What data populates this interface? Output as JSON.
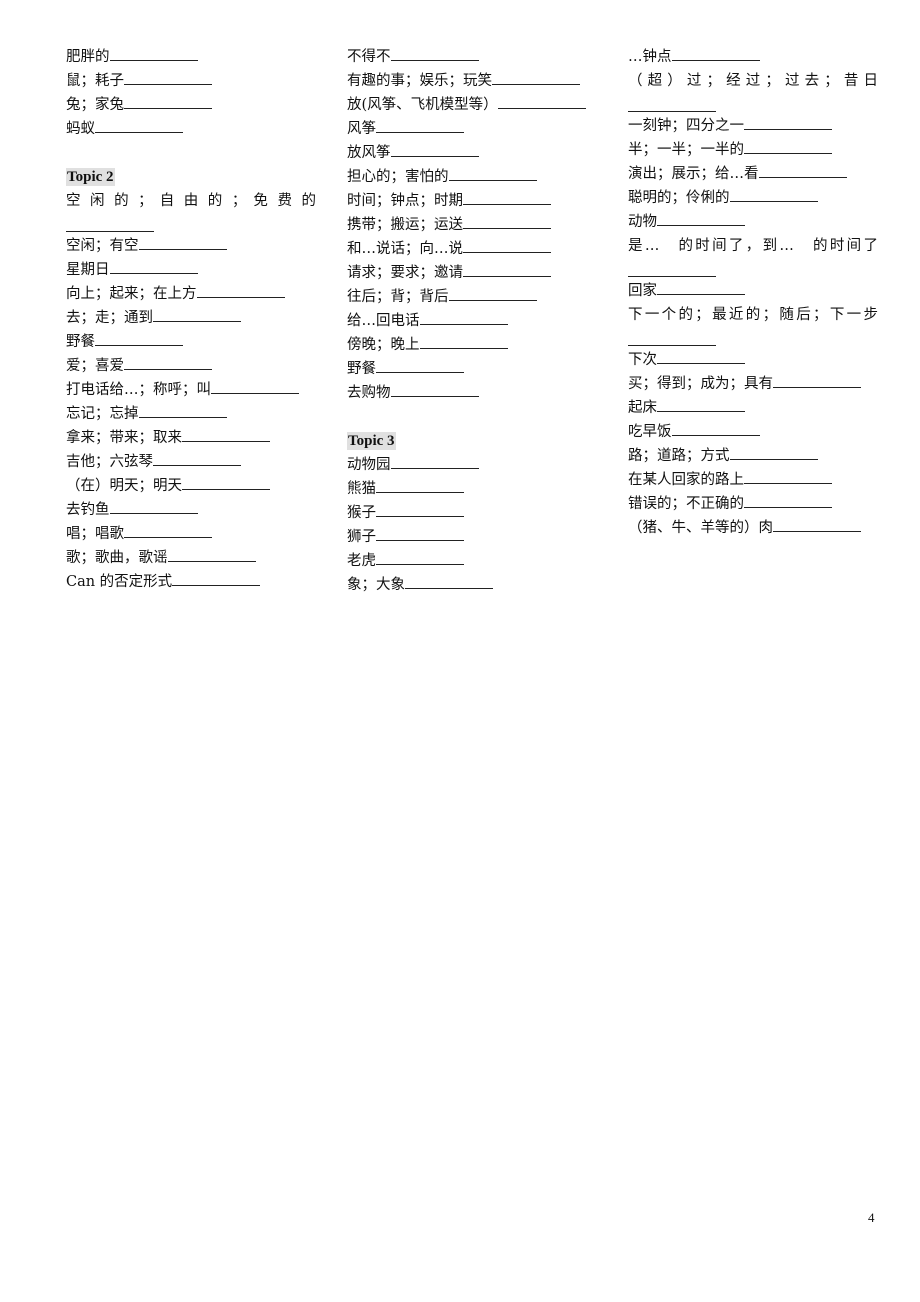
{
  "columns": [
    {
      "blocks": [
        {
          "type": "item",
          "text": "肥胖的"
        },
        {
          "type": "item",
          "text": "鼠；耗子"
        },
        {
          "type": "item",
          "text": "兔；家兔"
        },
        {
          "type": "item",
          "text": "蚂蚁"
        },
        {
          "type": "spacer"
        },
        {
          "type": "topic",
          "text": "Topic 2"
        },
        {
          "type": "wrap",
          "text": "空 闲 的 ； 自 由 的 ； 免 费 的"
        },
        {
          "type": "item",
          "text": "空闲；有空"
        },
        {
          "type": "item",
          "text": "星期日"
        },
        {
          "type": "item",
          "text": "向上；起来；在上方"
        },
        {
          "type": "item",
          "text": "去；走；通到"
        },
        {
          "type": "item",
          "text": "野餐"
        },
        {
          "type": "item",
          "text": "爱；喜爱"
        },
        {
          "type": "item",
          "text": "打电话给…；称呼；叫"
        },
        {
          "type": "item",
          "text": "忘记；忘掉"
        },
        {
          "type": "item",
          "text": "拿来；带来；取来"
        },
        {
          "type": "item",
          "text": "吉他；六弦琴"
        },
        {
          "type": "item",
          "text": "（在）明天；明天"
        },
        {
          "type": "item",
          "text": "去钓鱼"
        },
        {
          "type": "item",
          "text": "唱；唱歌"
        },
        {
          "type": "item",
          "text": "歌；歌曲，歌谣"
        },
        {
          "type": "item",
          "text": "Can 的否定形式"
        }
      ]
    },
    {
      "blocks": [
        {
          "type": "item",
          "text": "不得不"
        },
        {
          "type": "item",
          "text": "有趣的事；娱乐；玩笑"
        },
        {
          "type": "item",
          "text": "放(风筝、飞机模型等）"
        },
        {
          "type": "item",
          "text": "风筝"
        },
        {
          "type": "item",
          "text": "放风筝"
        },
        {
          "type": "item",
          "text": "担心的；害怕的"
        },
        {
          "type": "item",
          "text": "时间；钟点；时期"
        },
        {
          "type": "item",
          "text": "携带；搬运；运送"
        },
        {
          "type": "item",
          "text": "和…说话；向…说"
        },
        {
          "type": "item",
          "text": "请求；要求；邀请"
        },
        {
          "type": "item",
          "text": "往后；背；背后"
        },
        {
          "type": "item",
          "text": "给…回电话"
        },
        {
          "type": "item",
          "text": "傍晚；晚上"
        },
        {
          "type": "item",
          "text": "野餐"
        },
        {
          "type": "item",
          "text": "去购物"
        },
        {
          "type": "spacer"
        },
        {
          "type": "topic",
          "text": "Topic 3"
        },
        {
          "type": "item",
          "text": "动物园"
        },
        {
          "type": "item",
          "text": "熊猫"
        },
        {
          "type": "item",
          "text": "猴子"
        },
        {
          "type": "item",
          "text": "狮子"
        },
        {
          "type": "item",
          "text": "老虎"
        },
        {
          "type": "item",
          "text": "象；大象"
        }
      ]
    },
    {
      "blocks": [
        {
          "type": "item",
          "text": "…钟点"
        },
        {
          "type": "wrap",
          "text": "（超）过；经过；过去；昔日"
        },
        {
          "type": "item",
          "text": "一刻钟；四分之一"
        },
        {
          "type": "item",
          "text": "半；一半；一半的"
        },
        {
          "type": "item",
          "text": "演出；展示；给…看"
        },
        {
          "type": "item",
          "text": "聪明的；伶俐的"
        },
        {
          "type": "item",
          "text": "动物"
        },
        {
          "type": "wrap",
          "text": "是…　的时间了，到…　的时间了"
        },
        {
          "type": "item",
          "text": "回家"
        },
        {
          "type": "wrap",
          "text": "下一个的；最近的；随后；下一步"
        },
        {
          "type": "item",
          "text": "下次"
        },
        {
          "type": "item",
          "text": "买；得到；成为；具有"
        },
        {
          "type": "item",
          "text": "起床"
        },
        {
          "type": "item",
          "text": "吃早饭"
        },
        {
          "type": "item",
          "text": "路；道路；方式"
        },
        {
          "type": "item",
          "text": "在某人回家的路上"
        },
        {
          "type": "item",
          "text": "错误的；不正确的"
        },
        {
          "type": "item",
          "text": "（猪、牛、羊等的）肉"
        }
      ]
    }
  ],
  "page_number": "4"
}
